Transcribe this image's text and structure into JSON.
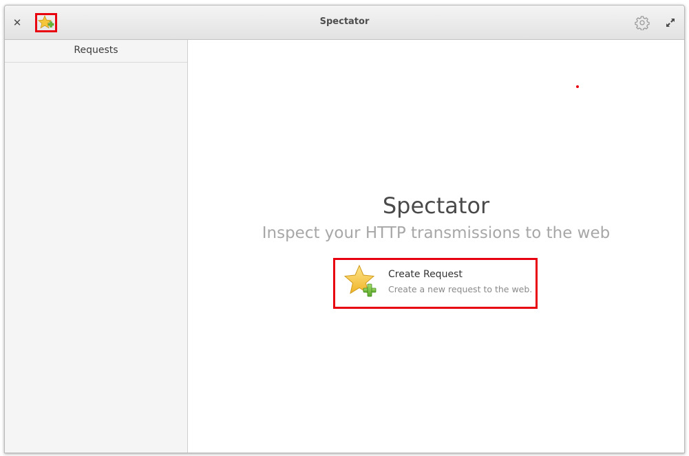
{
  "window": {
    "title": "Spectator"
  },
  "headerbar": {
    "close_icon": "close-icon",
    "new_request_icon": "star-add-icon",
    "settings_icon": "gear-icon",
    "maximize_icon": "maximize-icon"
  },
  "sidebar": {
    "header": "Requests"
  },
  "welcome": {
    "title": "Spectator",
    "subtitle": "Inspect your HTTP transmissions to the web",
    "action": {
      "title": "Create Request",
      "description": "Create a new request to the web.",
      "icon": "star-add-icon"
    }
  },
  "colors": {
    "highlight": "#e8000e",
    "star": "#f5c53a",
    "plus": "#6fbe3a"
  }
}
